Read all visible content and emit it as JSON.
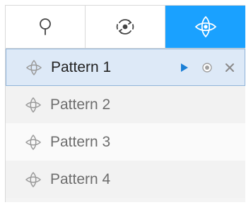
{
  "tabs": [
    {
      "icon": "search-icon",
      "active": false
    },
    {
      "icon": "ptz-rotate-icon",
      "active": false
    },
    {
      "icon": "pattern-icon",
      "active": true
    }
  ],
  "patterns": [
    {
      "label": "Pattern 1",
      "selected": true
    },
    {
      "label": "Pattern 2",
      "selected": false
    },
    {
      "label": "Pattern 3",
      "selected": false
    },
    {
      "label": "Pattern 4",
      "selected": false
    }
  ],
  "actions": [
    {
      "icon": "play-icon"
    },
    {
      "icon": "record-icon"
    },
    {
      "icon": "close-icon"
    }
  ],
  "colors": {
    "accent": "#1aa1ff",
    "selected_bg": "#dde9f7",
    "selected_border": "#8fb3d9",
    "text": "#6d6d6d",
    "text_selected": "#222222"
  }
}
